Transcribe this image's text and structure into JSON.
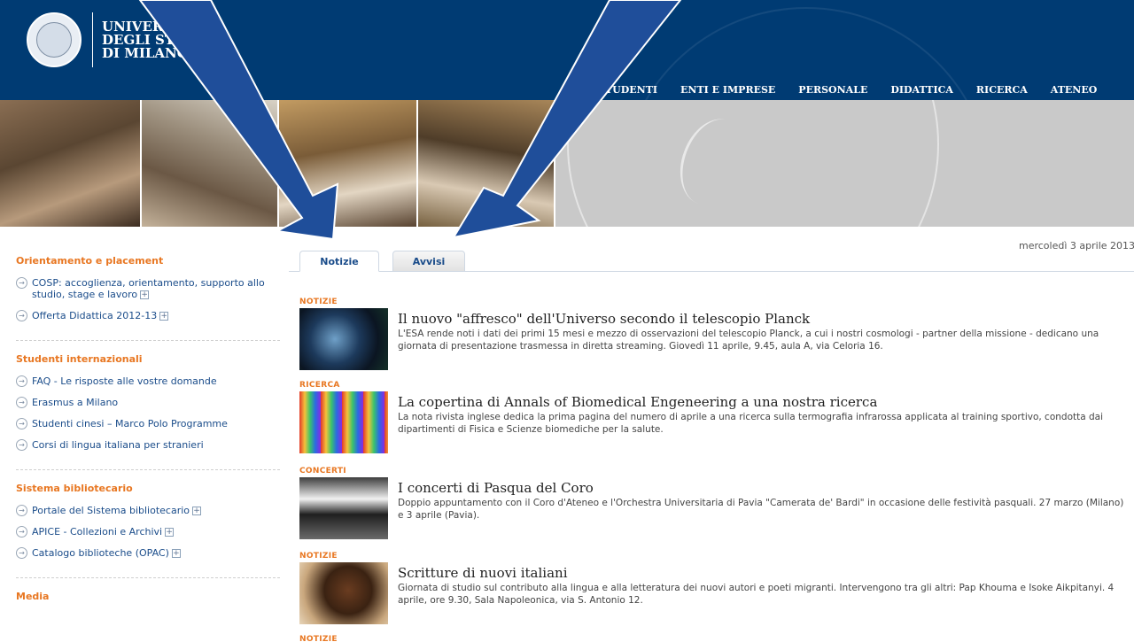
{
  "header": {
    "logo_line1": "UNIVERSITÀ",
    "logo_line2": "DEGLI STUDI",
    "logo_line3": "DI MILANO",
    "nav": [
      "STUDENTI",
      "ENTI E IMPRESE",
      "PERSONALE",
      "DIDATTICA",
      "RICERCA",
      "ATENEO"
    ]
  },
  "date": "mercoledì 3 aprile 2013",
  "sidebar": {
    "sections": [
      {
        "title": "Orientamento e placement",
        "items": [
          {
            "label": "COSP: accoglienza, orientamento, supporto allo studio, stage e lavoro",
            "expand": true
          },
          {
            "label": "Offerta Didattica 2012-13",
            "expand": true
          }
        ]
      },
      {
        "title": "Studenti internazionali",
        "items": [
          {
            "label": "FAQ - Le risposte alle vostre domande",
            "expand": false
          },
          {
            "label": "Erasmus a Milano",
            "expand": false
          },
          {
            "label": "Studenti cinesi – Marco Polo Programme",
            "expand": false
          },
          {
            "label": "Corsi di lingua italiana per stranieri",
            "expand": false
          }
        ]
      },
      {
        "title": "Sistema bibliotecario",
        "items": [
          {
            "label": "Portale del Sistema bibliotecario",
            "expand": true
          },
          {
            "label": "APICE - Collezioni e Archivi",
            "expand": true
          },
          {
            "label": "Catalogo biblioteche (OPAC)",
            "expand": true
          }
        ]
      }
    ],
    "media_title": "Media"
  },
  "tabs": {
    "active": "Notizie",
    "inactive": "Avvisi"
  },
  "news": [
    {
      "category": "NOTIZIE",
      "title": "Il nuovo \"affresco\" dell'Universo secondo il telescopio Planck",
      "text": "L'ESA rende noti i dati dei primi 15 mesi e mezzo di osservazioni del telescopio Planck, a cui i nostri cosmologi - partner della missione - dedicano una giornata di presentazione trasmessa in diretta streaming. Giovedì 11 aprile, 9.45, aula A, via Celoria 16."
    },
    {
      "category": "RICERCA",
      "title": "La copertina di Annals of Biomedical Engeneering a una nostra ricerca",
      "text": "La nota rivista inglese dedica la prima pagina del numero di aprile a una ricerca sulla termografia infrarossa applicata al training sportivo, condotta dai dipartimenti di Fisica e Scienze biomediche per la salute."
    },
    {
      "category": "CONCERTI",
      "title": "I concerti di Pasqua del Coro",
      "text": "Doppio appuntamento con il Coro d'Ateneo e l'Orchestra Universitaria di Pavia \"Camerata de' Bardi\" in occasione delle festività pasquali. 27 marzo (Milano) e 3 aprile (Pavia)."
    },
    {
      "category": "NOTIZIE",
      "title": "Scritture di nuovi italiani",
      "text": "Giornata di studio sul contributo alla lingua e alla letteratura dei nuovi autori e poeti migranti. Intervengono tra gli altri: Pap Khouma e Isoke Aikpitanyi. 4 aprile, ore 9.30, Sala Napoleonica, via S. Antonio 12."
    },
    {
      "category": "NOTIZIE"
    }
  ],
  "colors": {
    "header_bg": "#003B73",
    "accent_orange": "#E87722",
    "link_blue": "#1a4c8a",
    "arrow_blue": "#1f4e9a"
  }
}
